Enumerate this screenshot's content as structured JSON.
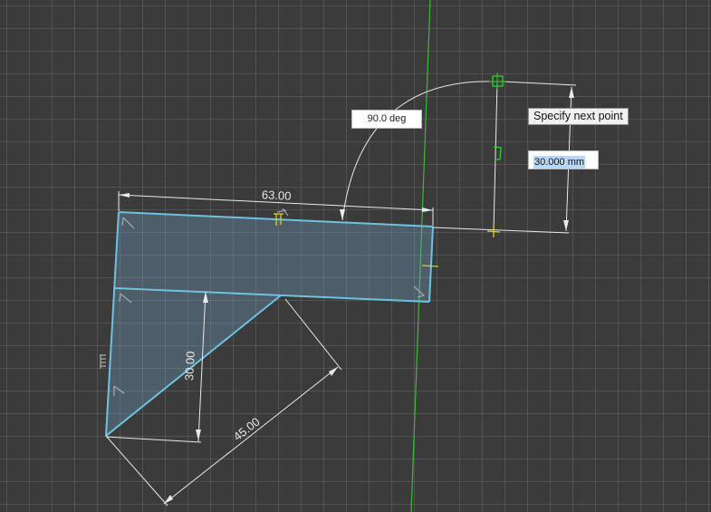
{
  "viewport": {
    "dimensions": {
      "width": "63.00",
      "height": "30.00",
      "hypotenuse": "45.00"
    },
    "angle_input": "90.0 deg",
    "tooltip": "Specify next point",
    "length_input": "30.000 mm"
  },
  "colors": {
    "background": "#3b3b3b",
    "sketch_edge": "#6ec2e0",
    "y_axis": "#3cb83c",
    "constraint_marker": "#d6d21e",
    "snap_marker": "#33cc33",
    "input_highlight": "#b9d7f5"
  },
  "icons": [
    "perpendicular-constraint-icon",
    "snap-point-icon",
    "constraint-glyph-icon"
  ]
}
